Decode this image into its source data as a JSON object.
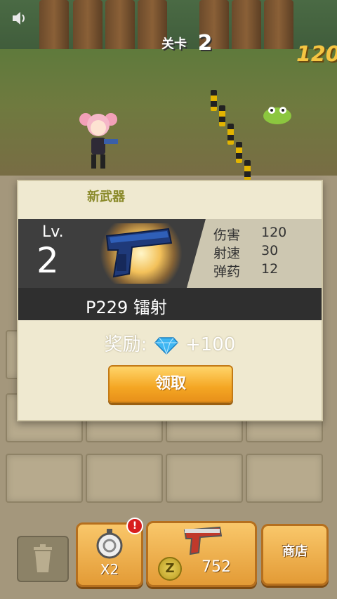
{
  "hud": {
    "level_label": "关卡",
    "level_value": "2",
    "coins_partial": "120",
    "sound_icon": "speaker-icon"
  },
  "modal": {
    "title": "新武器",
    "level_label": "Lv.",
    "level_value": "2",
    "weapon_name": "P229 镭射",
    "stats": [
      {
        "label": "伤害",
        "value": "120"
      },
      {
        "label": "射速",
        "value": "30"
      },
      {
        "label": "弹药",
        "value": "12"
      }
    ],
    "reward_label": "奖励:",
    "reward_icon": "diamond-icon",
    "reward_value": "+100",
    "claim_label": "领取"
  },
  "bottom_bar": {
    "trash_icon": "trash-icon",
    "speed_label": "X2",
    "speed_icon": "stopwatch-icon",
    "buy_icon": "pistol-icon",
    "coin_symbol": "Z",
    "buy_price": "752",
    "shop_label": "商店",
    "alert_badge": "!"
  },
  "colors": {
    "claim_button": "#f4a623",
    "modal_bg": "#efe9d0",
    "band_dark": "#3e3e3e",
    "gem": "#3fb6f2"
  }
}
